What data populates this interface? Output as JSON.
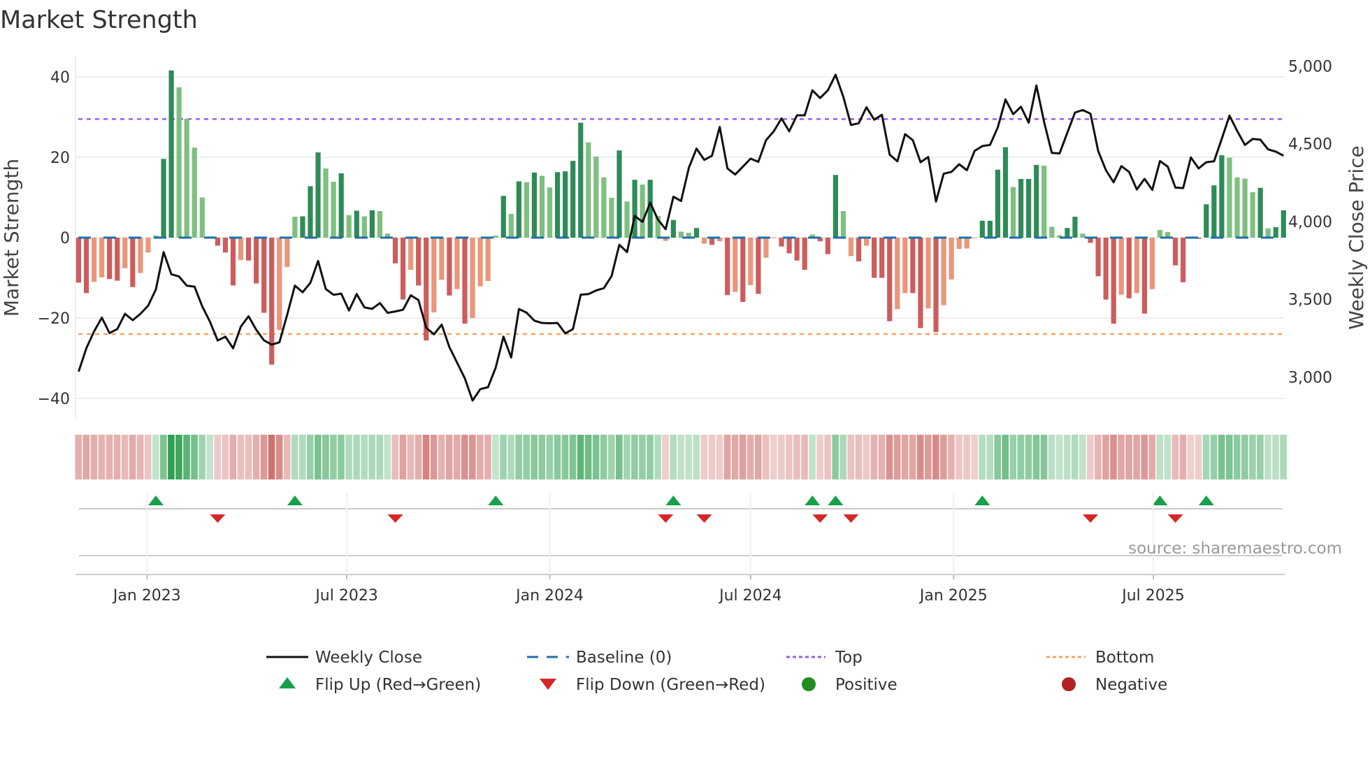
{
  "chart_data": {
    "type": "bar",
    "title": "Market Strength",
    "ylabel": "Market Strength",
    "y2label": "Weekly Close Price",
    "ylim": [
      -45,
      45
    ],
    "yticks": [
      40,
      20,
      0,
      -20,
      -40
    ],
    "ytick_labels": [
      "40",
      "20",
      "0",
      "−20",
      "−40"
    ],
    "y2ticks": [
      5000,
      4500,
      4000,
      3500,
      3000
    ],
    "y2tick_labels": [
      "5,000",
      "4,500",
      "4,000",
      "3,500",
      "3,000"
    ],
    "first_week": "2022-10-31",
    "frequency": "weekly",
    "xticks": [
      {
        "date": "2023-01-01",
        "label": "Jan 2023"
      },
      {
        "date": "2023-07-01",
        "label": "Jul 2023"
      },
      {
        "date": "2024-01-01",
        "label": "Jan 2024"
      },
      {
        "date": "2024-07-01",
        "label": "Jul 2024"
      },
      {
        "date": "2025-01-01",
        "label": "Jan 2025"
      },
      {
        "date": "2025-07-01",
        "label": "Jul 2025"
      }
    ],
    "top_level": 29.5,
    "bottom_level": -24,
    "baseline": 0,
    "strength": [
      -11.2,
      -13.8,
      -11,
      -9.9,
      -10.3,
      -10.7,
      -7.6,
      -12.3,
      -8.8,
      -3.7,
      0.5,
      19.6,
      41.6,
      37.4,
      29.6,
      22.4,
      10,
      0.3,
      -2,
      -3.7,
      -11.9,
      -5.6,
      -5.7,
      -11.4,
      -18.7,
      -31.6,
      -23,
      -7.3,
      5.2,
      5.3,
      12.8,
      21.2,
      17.2,
      13.9,
      16,
      5.6,
      6.7,
      5.3,
      6.8,
      6.6,
      1,
      -6.4,
      -15.4,
      -8,
      -11.9,
      -25.6,
      -18.6,
      -10.5,
      -14.4,
      -12.8,
      -21.4,
      -20,
      -12.1,
      -10.8,
      0.5,
      10.4,
      5.9,
      14,
      13.8,
      16.2,
      15.4,
      12.5,
      16.3,
      16.5,
      19.1,
      28.6,
      23.7,
      20.2,
      15,
      9.9,
      21.7,
      9,
      14.4,
      13.2,
      14.4,
      5.4,
      -0.8,
      4.4,
      1.5,
      1.2,
      2.4,
      -1.5,
      -1.8,
      -0.9,
      -14.3,
      -13.5,
      -16,
      -11.8,
      -14,
      -5,
      -0.1,
      -2.2,
      -3.9,
      -5.7,
      -8,
      0.8,
      -0.9,
      -4.1,
      15.6,
      6.6,
      -4.6,
      -5.9,
      -2,
      -10,
      -10,
      -20.8,
      -17.8,
      -13.8,
      -13.8,
      -22.5,
      -17.6,
      -23.5,
      -16.8,
      -10.4,
      -2.8,
      -2.7,
      -0.1,
      4.2,
      4.2,
      16.9,
      22.5,
      12.6,
      14.6,
      14.6,
      18.1,
      17.9,
      2.7,
      0.6,
      2.4,
      5.2,
      1,
      -1.3,
      -9.6,
      -15.4,
      -21.4,
      -14.2,
      -15.1,
      -13.8,
      -18.9,
      -12.8,
      1.9,
      1.4,
      -6.9,
      -11.1,
      -0.2,
      -0.3,
      8.3,
      13,
      20.5,
      19.9,
      15,
      14.7,
      11.3,
      12.4,
      2.3,
      2.6,
      6.8
    ],
    "weekly_close": [
      3034,
      3184,
      3293,
      3381,
      3282,
      3308,
      3406,
      3365,
      3406,
      3458,
      3563,
      3803,
      3661,
      3646,
      3587,
      3581,
      3454,
      3355,
      3234,
      3259,
      3184,
      3324,
      3390,
      3303,
      3235,
      3207,
      3223,
      3401,
      3587,
      3545,
      3605,
      3746,
      3565,
      3528,
      3536,
      3427,
      3533,
      3447,
      3438,
      3475,
      3412,
      3421,
      3432,
      3525,
      3494,
      3316,
      3274,
      3336,
      3192,
      3091,
      2991,
      2848,
      2921,
      2934,
      3060,
      3259,
      3125,
      3437,
      3413,
      3362,
      3347,
      3345,
      3347,
      3280,
      3308,
      3529,
      3533,
      3556,
      3571,
      3649,
      3850,
      3803,
      4036,
      3997,
      4121,
      4012,
      3950,
      4159,
      4132,
      4345,
      4469,
      4396,
      4423,
      4608,
      4341,
      4302,
      4353,
      4404,
      4384,
      4523,
      4580,
      4663,
      4580,
      4683,
      4683,
      4844,
      4794,
      4844,
      4944,
      4802,
      4621,
      4632,
      4735,
      4655,
      4686,
      4430,
      4387,
      4562,
      4523,
      4381,
      4415,
      4128,
      4307,
      4319,
      4368,
      4330,
      4454,
      4485,
      4492,
      4605,
      4785,
      4690,
      4738,
      4635,
      4875,
      4639,
      4441,
      4438,
      4570,
      4701,
      4717,
      4693,
      4454,
      4330,
      4252,
      4356,
      4319,
      4206,
      4274,
      4203,
      4389,
      4353,
      4218,
      4215,
      4412,
      4341,
      4381,
      4387,
      4531,
      4681,
      4582,
      4492,
      4531,
      4526,
      4464,
      4449,
      4423
    ],
    "legend": {
      "placement": "bottom",
      "items": [
        {
          "label": "Weekly Close",
          "kind": "line"
        },
        {
          "label": "Baseline (0)",
          "kind": "dash"
        },
        {
          "label": "Top",
          "kind": "dot-top"
        },
        {
          "label": "Bottom",
          "kind": "dot-bottom"
        },
        {
          "label": "Flip Up (Red→Green)",
          "kind": "tri-up"
        },
        {
          "label": "Flip Down (Green→Red)",
          "kind": "tri-down"
        },
        {
          "label": "Positive",
          "kind": "circle-pos"
        },
        {
          "label": "Negative",
          "kind": "circle-neg"
        }
      ]
    },
    "source": "source: sharemaestro.com",
    "colors": {
      "green_dark": "#2e8b57",
      "green_light": "#7fbf7f",
      "red_dark": "#cd5c5c",
      "red_light": "#e9967a",
      "line": "#111111",
      "baseline": "#1f6fa8",
      "top": "#9b5de5",
      "bottom": "#f4a261",
      "flip_up": "#17a04a",
      "flip_down": "#d62728",
      "positive": "#228b22",
      "negative": "#b22222"
    }
  }
}
